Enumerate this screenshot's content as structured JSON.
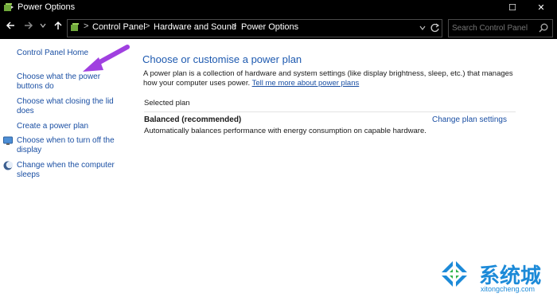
{
  "window": {
    "title": "Power Options",
    "app_icon": "power-options-icon",
    "controls": {
      "minimize": "—",
      "maximize": "☐",
      "close": "✕"
    }
  },
  "addressbar": {
    "back_icon": "back-arrow-icon",
    "forward_icon": "forward-arrow-icon",
    "dropdown_icon": "chevron-down-icon",
    "up_icon": "up-arrow-icon",
    "breadcrumbs": [
      "Control Panel",
      "Hardware and Sound",
      "Power Options"
    ],
    "separator": ">",
    "refresh_icon": "refresh-icon",
    "search_placeholder": "Search Control Panel"
  },
  "sidebar": {
    "home_label": "Control Panel Home",
    "items": [
      {
        "label": "Choose what the power buttons do",
        "icon": null
      },
      {
        "label": "Choose what closing the lid does",
        "icon": null
      },
      {
        "label": "Create a power plan",
        "icon": null
      },
      {
        "label": "Choose when to turn off the display",
        "icon": "display-icon"
      },
      {
        "label": "Change when the computer sleeps",
        "icon": "moon-icon"
      }
    ]
  },
  "main": {
    "heading": "Choose or customise a power plan",
    "description": "A power plan is a collection of hardware and system settings (like display brightness, sleep, etc.) that manages how your computer uses power.",
    "learn_more_link": "Tell me more about power plans",
    "selected_plan_label": "Selected plan",
    "plan": {
      "name": "Balanced (recommended)",
      "change_link": "Change plan settings",
      "description": "Automatically balances performance with energy consumption on capable hardware."
    }
  },
  "watermark": {
    "text_cn": "系统城",
    "text_en": "xitongcheng.com"
  },
  "colors": {
    "link": "#1a4fa3",
    "heading": "#1e5ab0",
    "arrow": "#a040e0",
    "watermark": "#1c8ad8"
  }
}
